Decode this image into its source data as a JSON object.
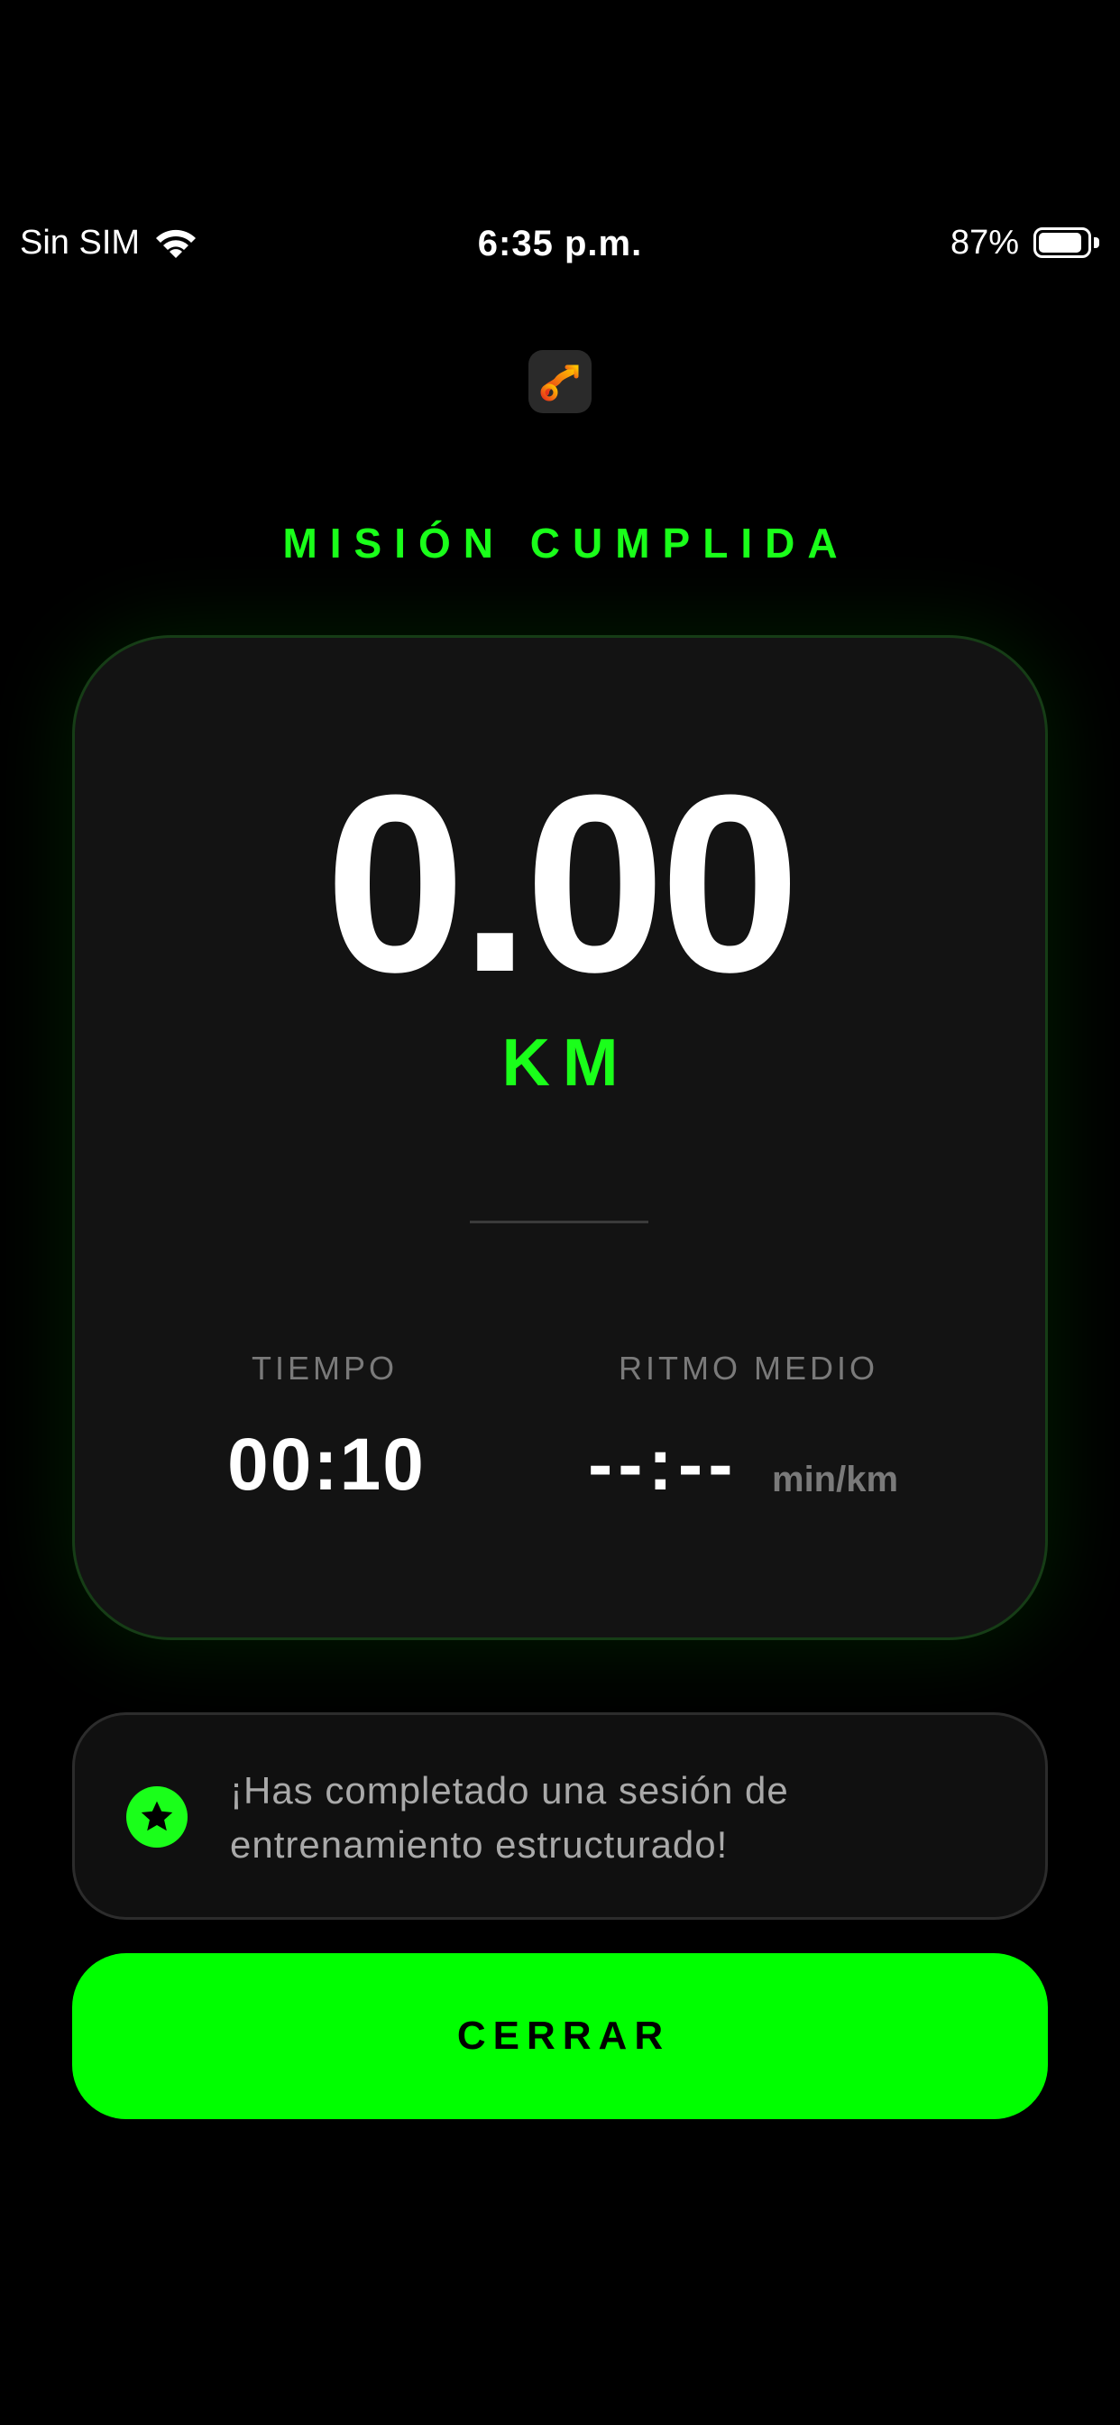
{
  "status_bar": {
    "carrier": "Sin SIM",
    "time": "6:35 p.m.",
    "battery_percent": "87%",
    "battery_level": 0.87,
    "icons": [
      "wifi-icon",
      "battery-icon"
    ]
  },
  "app_icon": "app-logo-icon",
  "title": "MISIÓN CUMPLIDA",
  "summary": {
    "distance_value": "0.00",
    "distance_unit": "KM",
    "time_label": "TIEMPO",
    "time_value": "00:10",
    "pace_label": "RITMO MEDIO",
    "pace_value": "--:--",
    "pace_unit": "min/km"
  },
  "info": {
    "icon": "star-icon",
    "message": "¡Has completado una sesión de entrenamiento estructurado!"
  },
  "actions": {
    "close_label": "CERRAR"
  },
  "colors": {
    "accent": "#00ff00",
    "background": "#000000",
    "card": "#131313",
    "muted_text": "#7a7a7a"
  }
}
